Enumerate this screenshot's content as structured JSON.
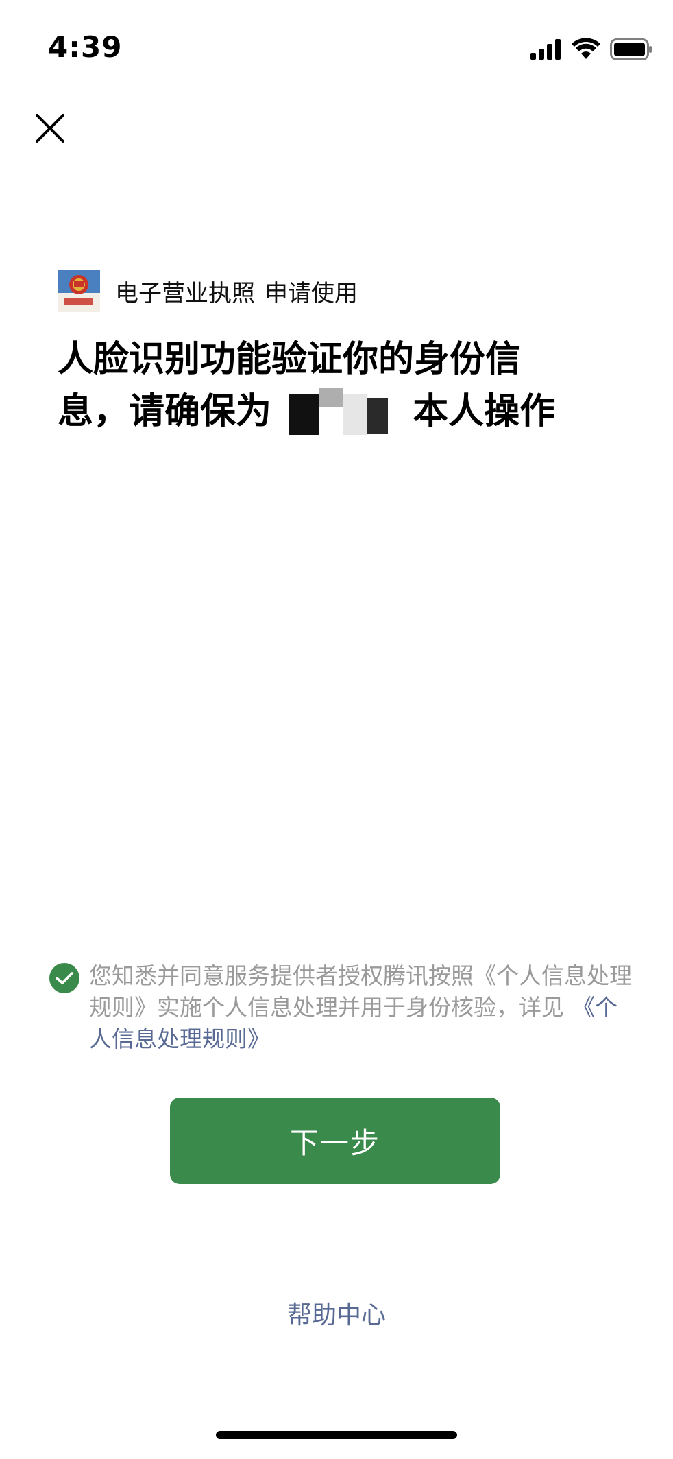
{
  "status_bar": {
    "time": "4:39",
    "icons": [
      "cellular-signal-icon",
      "wifi-icon",
      "battery-icon"
    ]
  },
  "header": {
    "close_icon": "close-icon"
  },
  "app_info": {
    "name": "电子营业执照",
    "action": "申请使用",
    "logo_icon": "national-emblem-icon",
    "logo_caption": "电子营业执照"
  },
  "title": {
    "line1": "人脸识别功能验证你的身份信",
    "line2_prefix": "息，请确保为",
    "line2_suffix": "本人操作"
  },
  "consent": {
    "checked": true,
    "text": "您知悉并同意服务提供者授权腾讯按照《个人信息处理规则》实施个人信息处理并用于身份核验，详见",
    "link": "《个人信息处理规则》"
  },
  "buttons": {
    "next": "下一步",
    "help": "帮助中心"
  },
  "colors": {
    "primary_green": "#3a8a4b",
    "link_blue": "#586a94",
    "muted_text": "#9a9a9a"
  }
}
